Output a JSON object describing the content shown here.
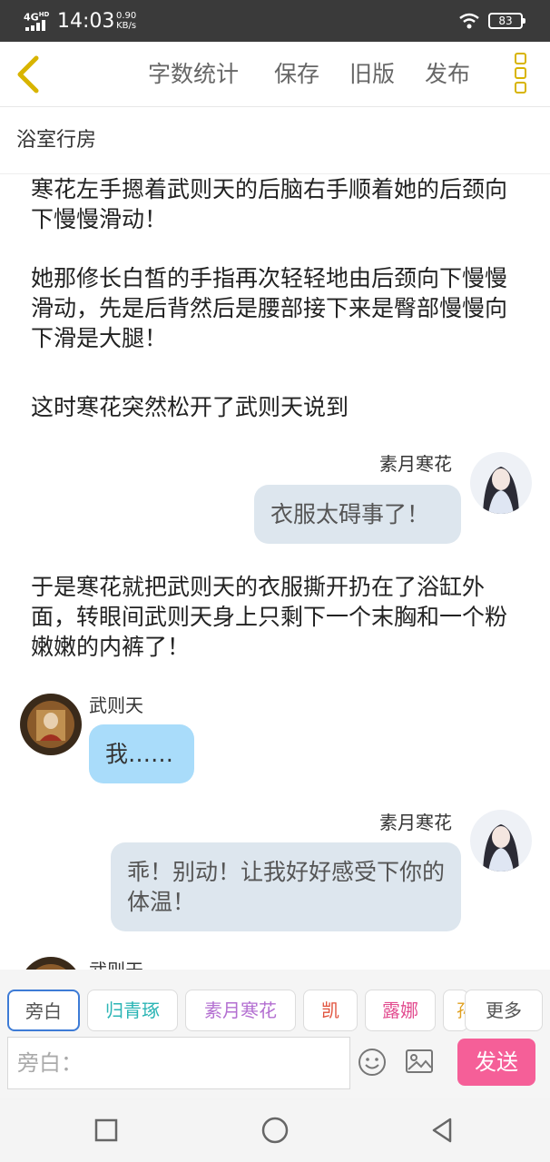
{
  "status_bar": {
    "network": "4G",
    "network_sub": "HD",
    "time": "14:03",
    "speed_value": "0.90",
    "speed_unit": "KB/s",
    "battery": "83"
  },
  "toolbar": {
    "word_count": "字数统计",
    "save": "保存",
    "old_version": "旧版",
    "publish": "发布"
  },
  "chapter": {
    "title": "浴室行房"
  },
  "messages": [
    {
      "type": "narration",
      "text": "寒花左手摁着武则天的后脑右手顺着她的后颈向下慢慢滑动！"
    },
    {
      "type": "narration",
      "text": "她那修长白皙的手指再次轻轻地由后颈向下慢慢滑动，先是后背然后是腰部接下来是臀部慢慢向下滑是大腿！"
    },
    {
      "type": "narration",
      "text": "这时寒花突然松开了武则天说到"
    },
    {
      "type": "dialog",
      "side": "right",
      "speaker": "素月寒花",
      "text": "衣服太碍事了！"
    },
    {
      "type": "narration",
      "text": "于是寒花就把武则天的衣服撕开扔在了浴缸外面，转眼间武则天身上只剩下一个末胸和一个粉嫩嫩的内裤了！"
    },
    {
      "type": "dialog",
      "side": "left",
      "speaker": "武则天",
      "text": "我……"
    },
    {
      "type": "dialog",
      "side": "right",
      "speaker": "素月寒花",
      "text": "乖！别动！让我好好感受下你的体温！"
    },
    {
      "type": "dialog",
      "side": "left",
      "speaker": "武则天",
      "text": ""
    }
  ],
  "characters": [
    {
      "label": "旁白",
      "color": "#555555"
    },
    {
      "label": "归青琢",
      "color": "#2bb5b5"
    },
    {
      "label": "素月寒花",
      "color": "#b36fd1"
    },
    {
      "label": "凯",
      "color": "#e0503a"
    },
    {
      "label": "露娜",
      "color": "#e24c8f"
    },
    {
      "label": "孙",
      "color": "#e0a020"
    }
  ],
  "more_label": "更多",
  "input": {
    "placeholder": "旁白："
  },
  "send_label": "发送"
}
